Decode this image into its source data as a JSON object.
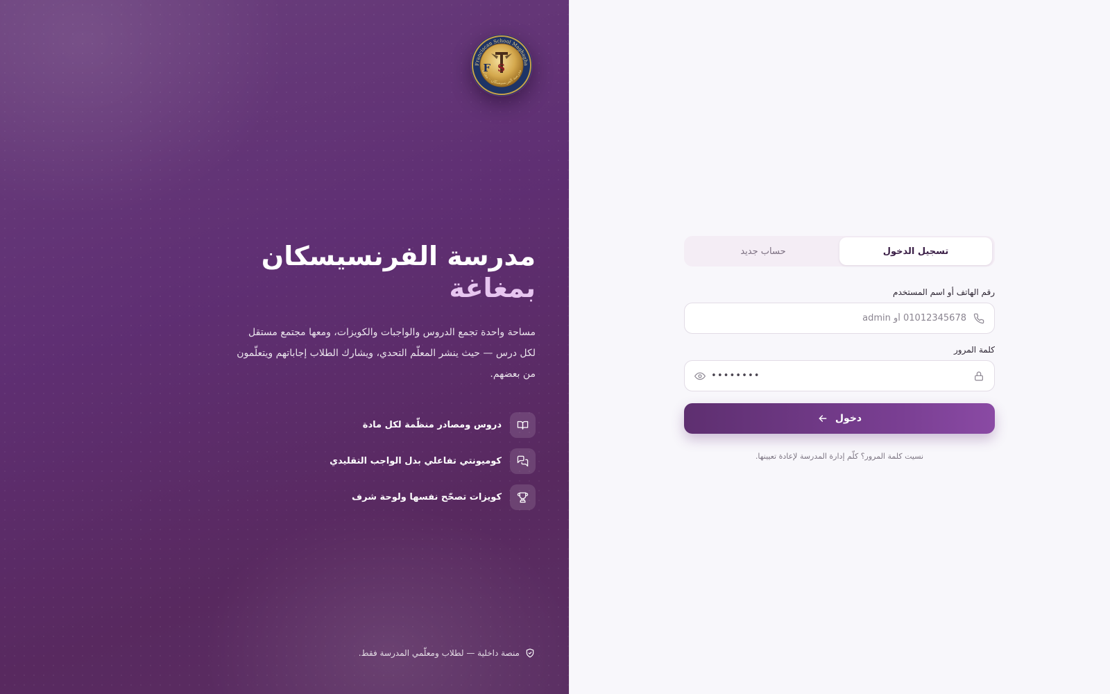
{
  "brand": {
    "logo_text_en": "Franciscan School Maghagha",
    "logo_monogram": "FTS",
    "logo_text_ar": "مدرسة الفرنسيسكان - مغاغة",
    "title": "مدرسة الفرنسيسكان",
    "subtitle": "بمغاغة",
    "description": "مساحة واحدة تجمع الدروس والواجبات والكويزات، ومعها مجتمع مستقل لكل درس — حيث ينشر المعلّم التحدي، ويشارك الطلاب إجاباتهم ويتعلّمون من بعضهم.",
    "features": [
      {
        "icon": "book-icon",
        "label": "دروس ومصادر منظّمة لكل مادة"
      },
      {
        "icon": "chat-icon",
        "label": "كوميونتي تفاعلي بدل الواجب التقليدي"
      },
      {
        "icon": "trophy-icon",
        "label": "كويزات تصحّح نفسها ولوحة شرف"
      }
    ],
    "footer_note": "منصة داخلية — لطلاب ومعلّمي المدرسة فقط."
  },
  "auth": {
    "tabs": [
      {
        "label": "تسجيل الدخول",
        "active": true
      },
      {
        "label": "حساب جديد",
        "active": false
      }
    ],
    "username_label": "رقم الهاتف أو اسم المستخدم",
    "username_placeholder": "01012345678 أو admin",
    "username_value": "",
    "password_label": "كلمة المرور",
    "password_mask": "••••••••",
    "submit_label": "دخول",
    "forgot_text": "نسيت كلمة المرور؟ كلّم إدارة المدرسة لإعادة تعيينها."
  },
  "colors": {
    "brand_purple": "#5f2f73",
    "accent_lilac": "#e7c6f0",
    "button_start": "#5e2f70",
    "button_end": "#8a4aa4"
  }
}
